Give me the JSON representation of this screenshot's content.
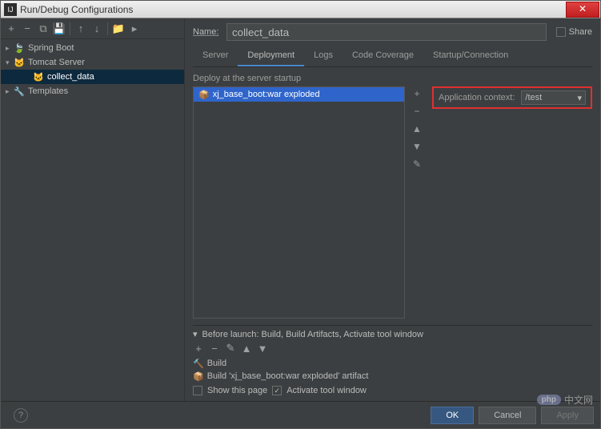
{
  "window": {
    "title": "Run/Debug Configurations"
  },
  "toolbar": {
    "add": "+",
    "remove": "−",
    "copy": "⧉",
    "save": "💾",
    "up": "↑",
    "down": "↓",
    "folder": "📁",
    "wrench": "▸"
  },
  "tree": {
    "items": [
      {
        "label": "Spring Boot",
        "icon": "🍃",
        "expanded": false,
        "indent": 0
      },
      {
        "label": "Tomcat Server",
        "icon": "🐱",
        "expanded": true,
        "indent": 0
      },
      {
        "label": "collect_data",
        "icon": "🐱",
        "selected": true,
        "indent": 2
      },
      {
        "label": "Templates",
        "icon": "🔧",
        "expanded": false,
        "indent": 0
      }
    ]
  },
  "form": {
    "name_label": "Name:",
    "name_value": "collect_data",
    "share_label": "Share"
  },
  "tabs": [
    {
      "label": "Server",
      "active": false
    },
    {
      "label": "Deployment",
      "active": true
    },
    {
      "label": "Logs",
      "active": false
    },
    {
      "label": "Code Coverage",
      "active": false
    },
    {
      "label": "Startup/Connection",
      "active": false
    }
  ],
  "deployment": {
    "section_label": "Deploy at the server startup",
    "artifact": "xj_base_boot:war exploded",
    "buttons": {
      "add": "+",
      "remove": "−",
      "up": "▲",
      "down": "▼",
      "edit": "✎"
    },
    "appctx_label": "Application context:",
    "appctx_value": "/test"
  },
  "before_launch": {
    "header": "Before launch: Build, Build Artifacts, Activate tool window",
    "toolbar": {
      "add": "+",
      "remove": "−",
      "edit": "✎",
      "up": "▲",
      "down": "▼"
    },
    "tasks": [
      {
        "icon": "🔨",
        "label": "Build"
      },
      {
        "icon": "📦",
        "label": "Build 'xj_base_boot:war exploded' artifact"
      }
    ],
    "show_page_label": "Show this page",
    "show_page_checked": false,
    "activate_label": "Activate tool window",
    "activate_checked": true
  },
  "footer": {
    "ok": "OK",
    "cancel": "Cancel",
    "apply": "Apply"
  },
  "watermark": {
    "php": "php",
    "cn": "中文网"
  }
}
